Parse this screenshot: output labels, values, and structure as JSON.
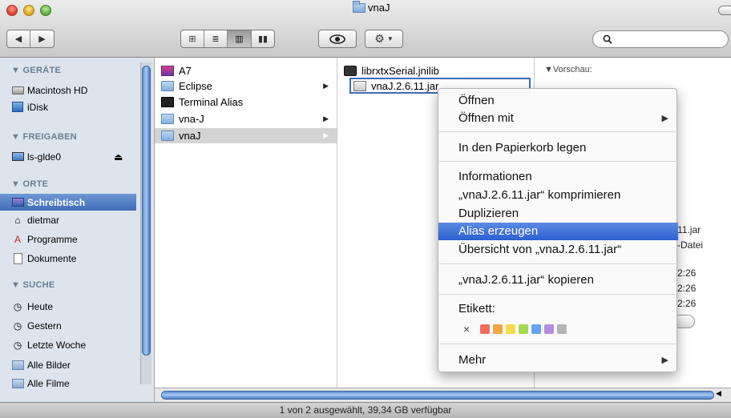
{
  "window": {
    "title": "vnaJ"
  },
  "toolbar": {
    "search_placeholder": "",
    "action_icon": "gear-icon",
    "quicklook_icon": "eye-icon"
  },
  "sidebar": {
    "devices_header": "▼ GERÄTE",
    "devices": [
      "Macintosh HD",
      "iDisk"
    ],
    "shared_header": "▼ FREIGABEN",
    "shared": [
      "ls-glde0"
    ],
    "places_header": "▼ ORTE",
    "places": [
      "Schreibtisch",
      "dietmar",
      "Programme",
      "Dokumente"
    ],
    "search_header": "▼ SUCHE",
    "searches": [
      "Heute",
      "Gestern",
      "Letzte Woche",
      "Alle Bilder",
      "Alle Filme"
    ]
  },
  "column1": {
    "items": [
      "A7",
      "Eclipse",
      "Terminal Alias",
      "vna-J",
      "vnaJ"
    ]
  },
  "column2": {
    "items": [
      "librxtxSerial.jnilib",
      "vnaJ.2.6.11.jar"
    ]
  },
  "preview": {
    "label": "▼Vorschau:",
    "fragments": [
      "11.jar",
      "-Datei",
      "2:26",
      "2:26",
      "2:26"
    ]
  },
  "context_menu": {
    "items": [
      "Öffnen",
      "Öffnen mit",
      "In den Papierkorb legen",
      "Informationen",
      "„vnaJ.2.6.11.jar“ komprimieren",
      "Duplizieren",
      "Alias erzeugen",
      "Übersicht von „vnaJ.2.6.11.jar“",
      "„vnaJ.2.6.11.jar“ kopieren",
      "Etikett:",
      "Mehr"
    ],
    "highlighted": "Alias erzeugen",
    "label_remove": "×",
    "label_colors": [
      "#f26b5b",
      "#f5a542",
      "#f5dd45",
      "#a7d954",
      "#65a4f0",
      "#b38ee0",
      "#b5b5b5"
    ]
  },
  "status": {
    "text": "1 von 2 ausgewählt, 39,34 GB verfügbar"
  },
  "colors": {
    "selection": "#3e6cb8",
    "menu_highlight": "#2d5fd0"
  }
}
